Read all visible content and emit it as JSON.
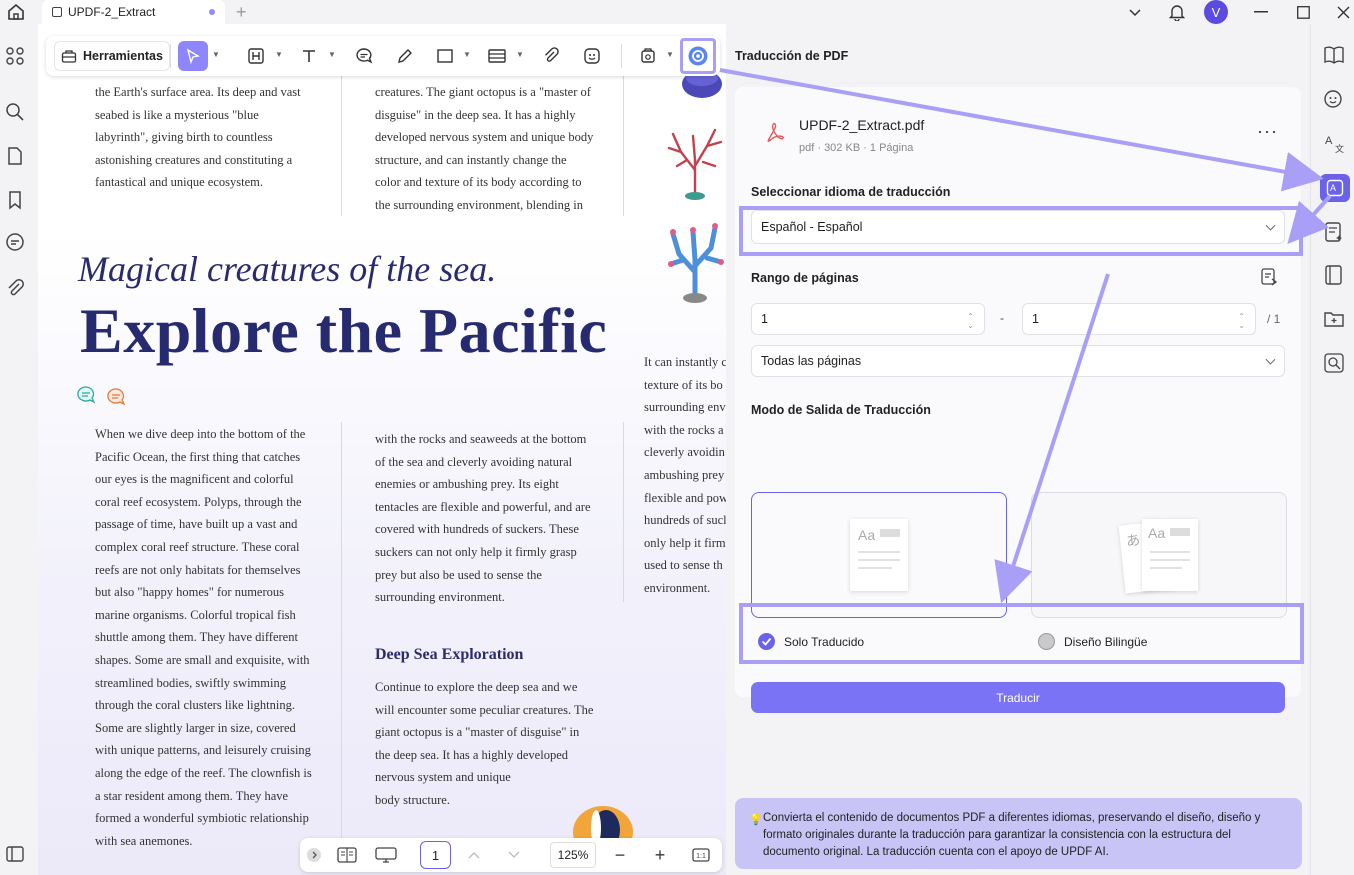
{
  "titlebar": {
    "tab_title": "UPDF-2_Extract",
    "new_tab": "+",
    "avatar_initial": "V"
  },
  "toolbar": {
    "tools_label": "Herramientas"
  },
  "document": {
    "top_left_text": "the Earth's surface area. Its deep and vast\nseabed is like a mysterious \"blue\nlabyrinth\", giving birth to countless\nastonishing creatures and constituting a\nfantastical and unique ecosystem.",
    "top_mid_text": "creatures. The giant octopus is a \"master of\ndisguise\" in the deep sea. It has a highly\ndeveloped nervous system and unique body\nstructure, and can instantly change the\ncolor and texture of its body according to\nthe surrounding environment, blending in",
    "subtitle": "Magical creatures of the sea.",
    "title": "Explore the Pacific",
    "left_col_text": "When we dive deep into the bottom of the\nPacific Ocean, the first thing that catches\nour eyes is the magnificent and colorful\ncoral reef ecosystem. Polyps, through the\npassage of time, have built up a vast and\ncomplex coral reef structure. These coral\nreefs are not only habitats for themselves\nbut also \"happy homes\" for numerous\nmarine organisms. Colorful tropical fish\nshuttle among them. They have different\nshapes. Some are small and exquisite, with\nstreamlined bodies, swiftly swimming\nthrough the coral clusters like lightning.\nSome are slightly larger in size, covered\nwith unique patterns, and leisurely cruising\nalong the edge of the reef. The clownfish is\na star resident among them. They have\nformed a wonderful symbiotic relationship\nwith sea anemones.",
    "mid_col_text": "with the rocks and seaweeds at the bottom\nof the sea and cleverly avoiding natural\nenemies or ambushing prey. Its eight\ntentacles are flexible and powerful, and are\ncovered with hundreds of suckers. These\nsuckers can not only help it firmly grasp\nprey but also be used to sense the\nsurrounding environment.",
    "section_heading": "Deep Sea Exploration",
    "section_text": "Continue to explore the deep sea and we\nwill encounter some peculiar creatures. The\ngiant octopus is a \"master of disguise\" in\nthe deep sea. It has a highly developed\nnervous system and unique\nbody structure.",
    "right_col_text": "It can instantly c\ntexture of its bo\nsurrounding env\nwith the rocks a\ncleverly avoidin\nambushing prey\nflexible and pow\nhundreds of sucl\nonly help it firm\nused to sense th\nenvironment."
  },
  "bottombar": {
    "page_number": "1",
    "zoom": "125%",
    "zoom_out": "−",
    "zoom_in": "+"
  },
  "panel": {
    "title": "Traducción de PDF",
    "file_name": "UPDF-2_Extract.pdf",
    "file_meta": "pdf · 302 KB · 1 Página",
    "more": "···",
    "language_label": "Seleccionar idioma de traducción",
    "language_value": "Español - Español",
    "range_label": "Rango de páginas",
    "range_from": "1",
    "range_dash": "-",
    "range_to": "1",
    "range_total": "/ 1",
    "pages_option": "Todas las páginas",
    "mode_label": "Modo de Salida de Traducción",
    "mode_only": "Solo Traducido",
    "mode_bilingual": "Diseño Bilingüe",
    "translate_button": "Traducir",
    "info_text": "Convierta el contenido de documentos PDF a diferentes idiomas, preservando el diseño, diseño y formato originales durante la traducción para garantizar la consistencia con la estructura del documento original. La traducción cuenta con el apoyo de UPDF AI.",
    "thumb_aa": "Aa",
    "thumb_jp": "あ"
  },
  "colors": {
    "accent": "#7b73f5",
    "highlight": "#a99ff7",
    "title_navy": "#262a6e"
  }
}
